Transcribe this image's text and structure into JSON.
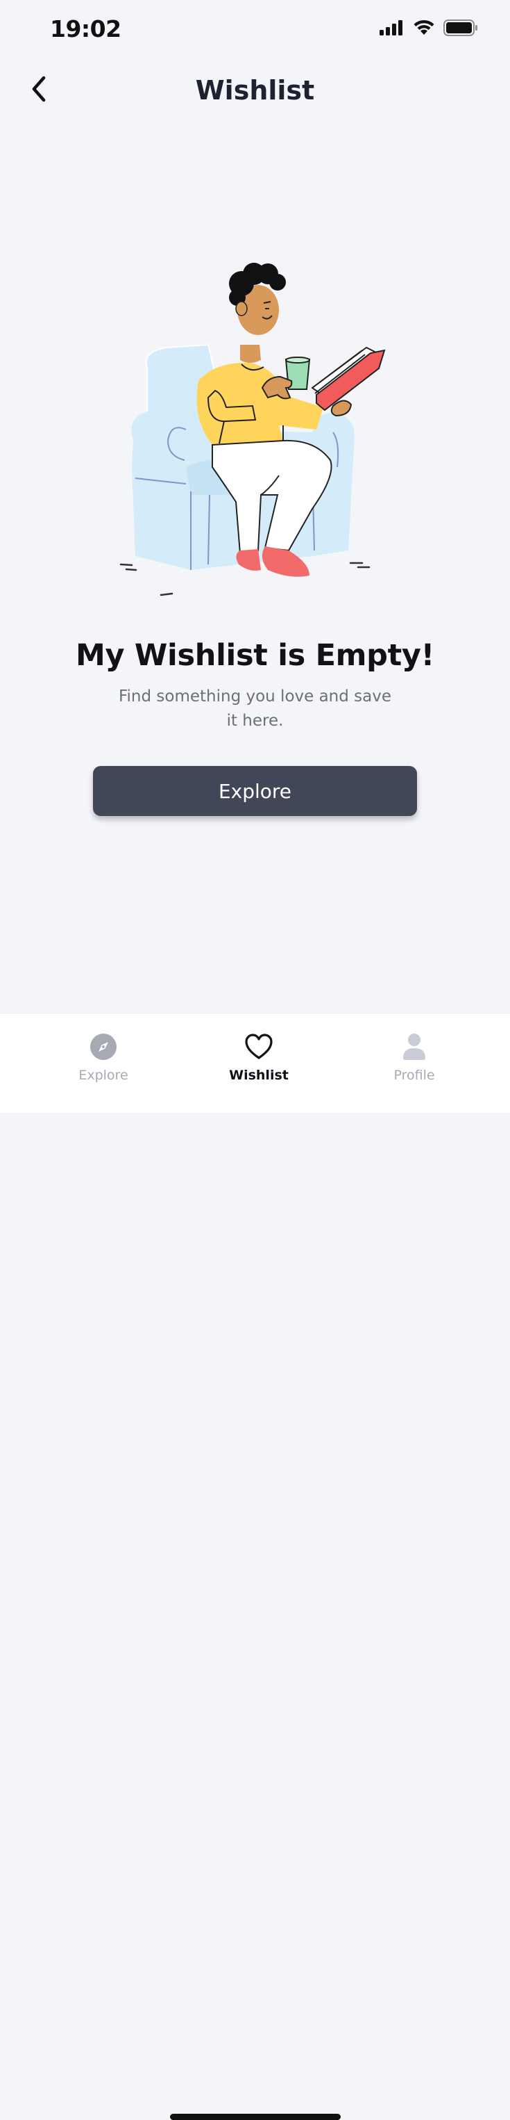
{
  "status_bar": {
    "time": "19:02"
  },
  "header": {
    "title": "Wishlist"
  },
  "empty_state": {
    "title": "My Wishlist is Empty!",
    "subtitle": "Find something you love and save it here.",
    "button_label": "Explore"
  },
  "tab_bar": {
    "tabs": [
      {
        "label": "Explore",
        "icon": "compass-icon",
        "active": false
      },
      {
        "label": "Wishlist",
        "icon": "heart-icon",
        "active": true
      },
      {
        "label": "Profile",
        "icon": "person-icon",
        "active": false
      }
    ]
  },
  "colors": {
    "background": "#f4f5f9",
    "button": "#414756",
    "inactive_tab": "#a7aab3",
    "active_tab": "#121318"
  }
}
